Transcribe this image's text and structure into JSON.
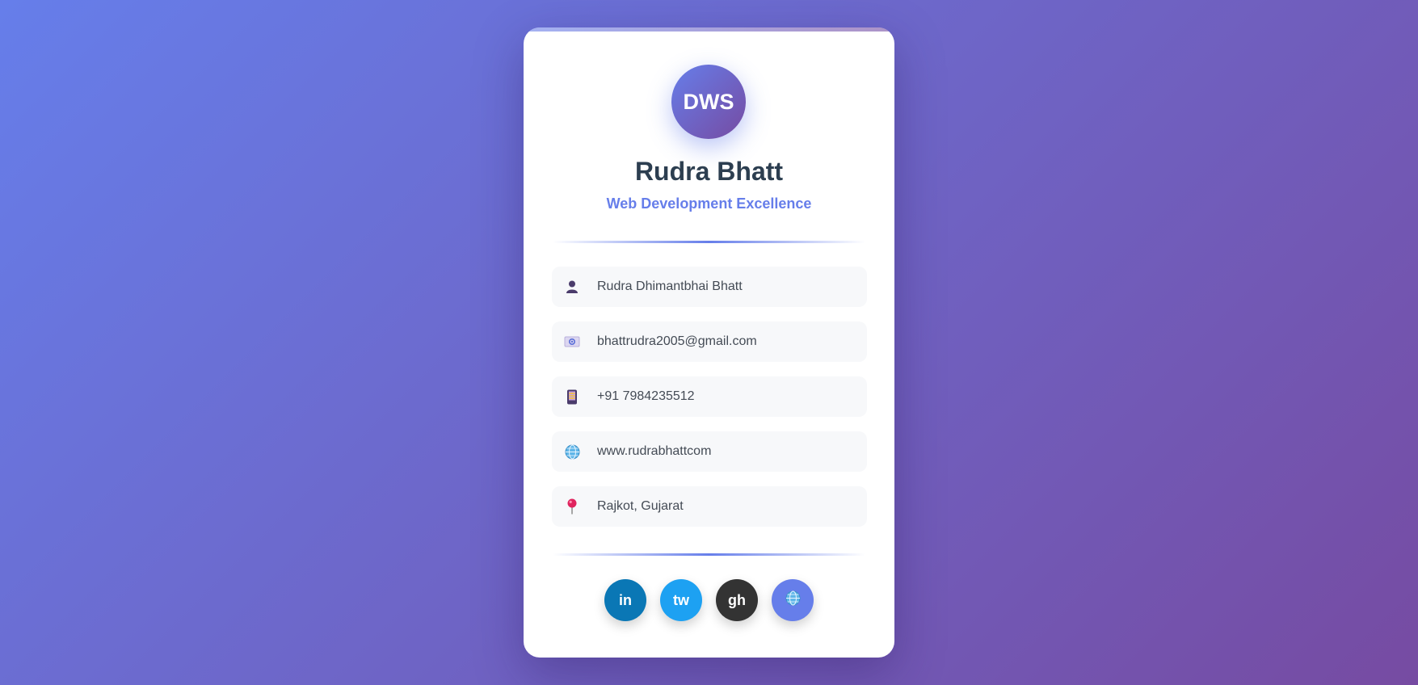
{
  "card": {
    "logo_text": "DWS",
    "name": "Rudra Bhatt",
    "tagline": "Web Development Excellence"
  },
  "info": [
    {
      "icon": "person-icon",
      "text": "Rudra Dhimantbhai Bhatt"
    },
    {
      "icon": "email-icon",
      "text": "bhattrudra2005@gmail.com"
    },
    {
      "icon": "phone-icon",
      "text": "+91 7984235512"
    },
    {
      "icon": "globe-icon",
      "text": "www.rudrabhattcom"
    },
    {
      "icon": "location-pin-icon",
      "text": "Rajkot, Gujarat"
    }
  ],
  "socials": [
    {
      "id": "linkedin",
      "label": "in",
      "color": "#0a77b5"
    },
    {
      "id": "twitter",
      "label": "tw",
      "color": "#1da1f2"
    },
    {
      "id": "github",
      "label": "gh",
      "color": "#333333"
    },
    {
      "id": "website",
      "label": "",
      "icon": "globe-icon",
      "color": "#667eea"
    }
  ],
  "colors": {
    "accent": "#667eea",
    "gradient_start": "#667eea",
    "gradient_end": "#764ba2",
    "name_color": "#2c3e50"
  }
}
